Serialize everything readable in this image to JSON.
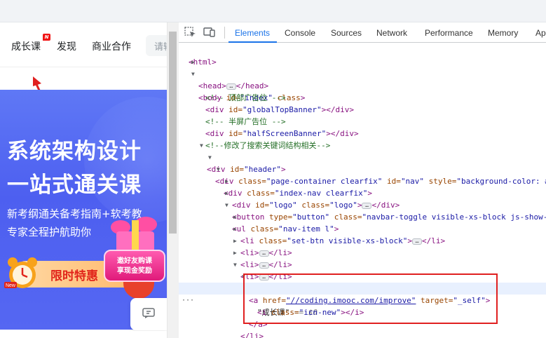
{
  "page": {
    "nav": {
      "items": [
        "成长课",
        "发现",
        "商业合作"
      ],
      "new_badge": "N",
      "search_placeholder": "请输"
    },
    "banner": {
      "title_line1": "系统架构设计",
      "title_line2": "一站式通关课",
      "sub_line1": "新考纲通关备考指南+软考教",
      "sub_line2": "专家全程护航助你",
      "promo": "限时特惠",
      "gift_line1": "邀好友购课",
      "gift_line2": "享现金奖励",
      "clock_tag": "New"
    }
  },
  "devtools": {
    "tabs": [
      "Elements",
      "Console",
      "Sources",
      "Network",
      "Performance",
      "Memory",
      "Ap"
    ],
    "active_tab": "Elements",
    "tree": {
      "l1": "<html>",
      "l2_tag_open": "<head>",
      "l2_tag_close": "</head>",
      "l3_open": "<body",
      "l3_attr1": " id=",
      "l3_val1": "\"index\"",
      "l3_attr2": " class",
      "l3_close": ">",
      "c1": "<!-- 顶部广告位 -->",
      "l5a": "<div",
      "l5b": " id=",
      "l5c": "\"globalTopBanner\"",
      "l5d": "></div>",
      "c2": "<!-- 半屏广告位 -->",
      "l7a": "<div",
      "l7b": " id=",
      "l7c": "\"halfScreenBanner\"",
      "l7d": "></div>",
      "c3": "<!--修改了搜索关键词结构相关-->",
      "l9a": "<div",
      "l9b": " id=",
      "l9c": "\"header\"",
      "l9d": ">",
      "l10a": "<div",
      "l10b": " class=",
      "l10c": "\"page-container clearfix\"",
      "l10d": " id=",
      "l10e": "\"nav\"",
      "l10f": " style=",
      "l10g": "\"background-color: #",
      "l11a": "<div",
      "l11b": " class=",
      "l11c": "\"index-nav clearfix\"",
      "l11d": ">",
      "l12a": "<div",
      "l12b": " id=",
      "l12c": "\"logo\"",
      "l12d": " class=",
      "l12e": "\"logo\"",
      "l12f": ">",
      "l12g": "</div>",
      "l13a": "<button",
      "l13b": " type=",
      "l13c": "\"button\"",
      "l13d": " class=",
      "l13e": "\"navbar-toggle visible-xs-block js-show-m",
      "l14a": "<ul",
      "l14b": " class=",
      "l14c": "\"nav-item l\"",
      "l14d": ">",
      "l15a": "<li",
      "l15b": " class=",
      "l15c": "\"set-btn visible-xs-block\"",
      "l15d": ">",
      "l15e": "</li>",
      "li_open": "<li>",
      "li_close": "</li>",
      "l20a": "<a",
      "l20b": " href=",
      "l20c": "\"//coding.imooc.com/improve\"",
      "l20d": " target=",
      "l20e": "\"_self\"",
      "l20f": ">",
      "l21_text": "\"成长课\"",
      "l21_eq": " == $0",
      "l22a": "<i",
      "l22b": " class=",
      "l22c": "\"icn-new\"",
      "l22d": "></i>",
      "l23": "</a>",
      "l24": "</li>",
      "ellipsis": "…",
      "gutter_dots": "···"
    }
  },
  "colors": {
    "accent": "#1a73e8",
    "highlight_box": "#e02020",
    "banner": "#5567f2"
  }
}
